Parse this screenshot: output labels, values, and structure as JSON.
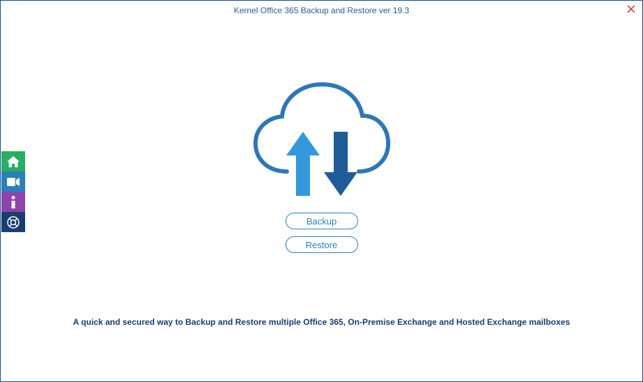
{
  "window": {
    "title": "Kernel Office 365 Backup and Restore ver 19.3"
  },
  "sidebar": {
    "home_icon": "home-icon",
    "video_icon": "video-icon",
    "info_icon": "info-icon",
    "help_icon": "help-icon"
  },
  "main": {
    "backup_label": "Backup",
    "restore_label": "Restore"
  },
  "footer": {
    "text": "A quick and secured way to Backup and Restore multiple Office 365, On-Premise Exchange and Hosted Exchange mailboxes"
  }
}
